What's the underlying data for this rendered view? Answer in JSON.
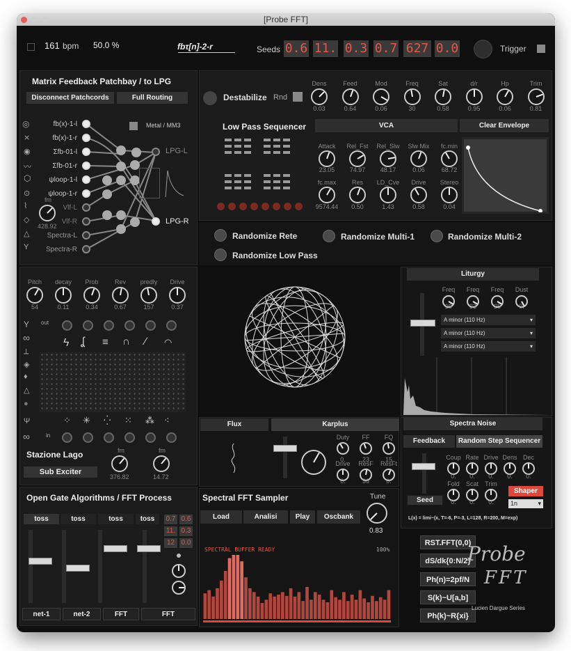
{
  "window": {
    "title": "[Probe FFT]"
  },
  "header": {
    "bpm_value": "161",
    "bpm_unit": "bpm",
    "percent": "50.0 %",
    "logo": "fbτ[n]-2-r",
    "seeds_label": "Seeds",
    "seeds": [
      "0.6",
      "11.",
      "0.3",
      "0.7",
      "627",
      "0.0"
    ],
    "trigger_label": "Trigger"
  },
  "patchbay": {
    "title": "Matrix Feedback Patchbay / to LPG",
    "disconnect": "Disconnect Patchcords",
    "full_routing": "Full Routing",
    "metal": "Metal / MM3",
    "inputs": [
      "fb(x)-1-l",
      "fb(x)-1-r",
      "Σfb-01-l",
      "Σfb-01-r",
      "ψloop-1-l",
      "ψloop-1-r",
      "Vlf-L",
      "Vlf-R",
      "Spectra-L",
      "Spectra-R"
    ],
    "outputs": [
      "LPG-L",
      "LPG-R"
    ],
    "fm_label": "fm",
    "fm_value": "428.92"
  },
  "destab": {
    "label": "Destabilize",
    "rnd": "Rnd",
    "knobs": [
      {
        "name": "Dens",
        "value": "0.03"
      },
      {
        "name": "Feed",
        "value": "0.64"
      },
      {
        "name": "Mod",
        "value": "0.06"
      },
      {
        "name": "Freq",
        "value": "30"
      },
      {
        "name": "Sat",
        "value": "0.58"
      },
      {
        "name": "d/r",
        "value": "0.95"
      },
      {
        "name": "Hp",
        "value": "0.06"
      },
      {
        "name": "Trim",
        "value": "0.81"
      }
    ]
  },
  "lps": {
    "title": "Low Pass Sequencer",
    "vca": "VCA",
    "clear_env": "Clear Envelope",
    "knobs_row1": [
      {
        "name": "Attack",
        "value": "23.05"
      },
      {
        "name": "Rel_Fst",
        "value": "74.97"
      },
      {
        "name": "Rel_Slw",
        "value": "48.17"
      },
      {
        "name": "Slw Mix",
        "value": "0.06"
      },
      {
        "name": "fc.min",
        "value": "68.72"
      }
    ],
    "knobs_row2": [
      {
        "name": "fc.max",
        "value": "9574.44"
      },
      {
        "name": "Res",
        "value": "0.50"
      },
      {
        "name": "LD_Cve",
        "value": "1.43"
      },
      {
        "name": "Drive",
        "value": "0.58"
      },
      {
        "name": "Stereo",
        "value": "0.04"
      }
    ]
  },
  "randomize": {
    "rete": "Randomize Rete",
    "multi1": "Randomize Multi-1",
    "multi2": "Randomize Multi-2",
    "lowpass": "Randomize Low Pass"
  },
  "exciter": {
    "knobs": [
      {
        "name": "Pitch",
        "value": "54"
      },
      {
        "name": "decay",
        "value": "0.11"
      },
      {
        "name": "Prob",
        "value": "0.34"
      },
      {
        "name": "Rev",
        "value": "0.67"
      },
      {
        "name": "predly",
        "value": "157"
      },
      {
        "name": "Drive",
        "value": "0.37"
      }
    ],
    "out_label": "out",
    "in_label": "in",
    "title": "Stazione Lago",
    "sub_exciter": "Sub Exciter",
    "fm1_label": "fm",
    "fm1_value": "376.82",
    "fm2_label": "fm",
    "fm2_value": "14.72"
  },
  "liturgy": {
    "title": "Liturgy",
    "knobs": [
      {
        "name": "Freq",
        "value": "29"
      },
      {
        "name": "Freq",
        "value": "33"
      },
      {
        "name": "Freq",
        "value": "25"
      },
      {
        "name": "Dust",
        "value": "0."
      }
    ],
    "drops": [
      "A minor (110 Hz)",
      "A minor (110 Hz)",
      "A minor (110 Hz)"
    ]
  },
  "flux": {
    "flux": "Flux",
    "karplus": "Karplus",
    "labels": [
      {
        "name": "Duty",
        "value": "0."
      },
      {
        "name": "FF",
        "value": "23"
      },
      {
        "name": "FQ",
        "value": "15"
      },
      {
        "name": "Drive",
        "value": "0."
      },
      {
        "name": "ResF",
        "value": "36"
      },
      {
        "name": "ResFt",
        "value": "0."
      }
    ]
  },
  "spectranoise": {
    "title": "Spectra Noise",
    "feedback": "Feedback",
    "random_step": "Random Step Sequencer",
    "knobs1": [
      {
        "name": "Coup",
        "value": "0."
      },
      {
        "name": "Rate",
        "value": "0."
      },
      {
        "name": "Drive",
        "value": "0."
      },
      {
        "name": "Dens",
        "value": "0."
      },
      {
        "name": "Dec",
        "value": "0."
      }
    ],
    "knobs2": [
      {
        "name": "Fold",
        "value": "0."
      },
      {
        "name": "Scat",
        "value": "0."
      },
      {
        "name": "Trim",
        "value": "0."
      }
    ],
    "seed": "Seed",
    "shaper": "Shaper",
    "shaper_sel": "1n",
    "formula": "L(x) = limi~(x, T=-6, P=-3, L=128, R=200, M=exp)"
  },
  "opengate": {
    "title": "Open Gate Algorithms / FFT Process",
    "toss": [
      "toss",
      "toss",
      "toss",
      "toss"
    ],
    "nums": [
      "0.7",
      "0.6",
      "11.",
      "0.3",
      "12",
      "0.0"
    ],
    "bottom": [
      "net-1",
      "net-2",
      "FFT",
      "FFT"
    ]
  },
  "sampler": {
    "title": "Spectral FFT Sampler",
    "buttons": [
      "Load",
      "Analisi",
      "Play",
      "Oscbank"
    ],
    "tune_label": "Tune",
    "tune_value": "0.83",
    "status": "SPECTRAL BUFFER READY",
    "percent": "100%",
    "bars": [
      0.4,
      0.45,
      0.35,
      0.48,
      0.6,
      0.75,
      0.95,
      1.0,
      1.0,
      0.9,
      0.65,
      0.48,
      0.42,
      0.35,
      0.25,
      0.3,
      0.4,
      0.35,
      0.38,
      0.42,
      0.36,
      0.48,
      0.35,
      0.42,
      0.28,
      0.5,
      0.3,
      0.42,
      0.38,
      0.3,
      0.26,
      0.45,
      0.34,
      0.3,
      0.42,
      0.28,
      0.38,
      0.3,
      0.45,
      0.32,
      0.26,
      0.36,
      0.28,
      0.34,
      0.3,
      0.45
    ]
  },
  "fftbuttons": [
    "RST.FFT(0,0)",
    "dS/dk{0:N/2}",
    "Ph(n)=2pf/N",
    "S(k)~U[a,b]",
    "Ph(k)~R{xi}"
  ],
  "signature": {
    "line1": "Probe",
    "line2": "FFT",
    "credit": "Lucien Dargue Series"
  },
  "colors": {
    "bg": "#0f0f0f",
    "panel": "#1b1b1b",
    "accent_red": "#e4564a",
    "shaper": "#d9493c"
  }
}
